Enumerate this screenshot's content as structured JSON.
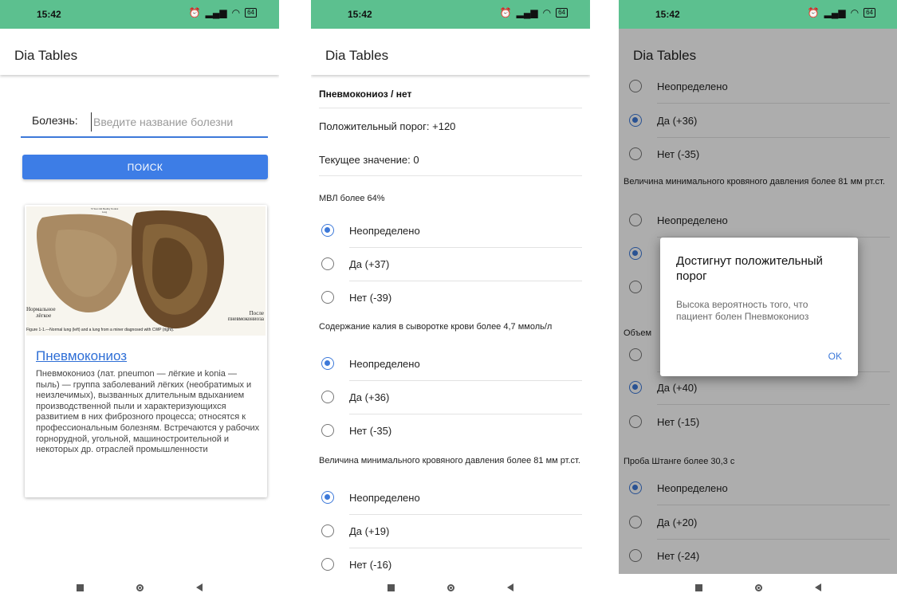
{
  "status": {
    "time": "15:42",
    "battery": "64"
  },
  "app_title": "Dia Tables",
  "search_screen": {
    "label": "Болезнь:",
    "placeholder": "Введите название болезни",
    "button_label": "ПОИСК",
    "card": {
      "image_top_label": "70 Year Old Healthy Normal Lung",
      "image_label_left_1": "Нормальное",
      "image_label_left_2": "лёгкое",
      "image_label_right_1": "После",
      "image_label_right_2": "пневмокониоза",
      "image_caption": "Figure 1-1.—Normal lung (left) and a lung from a miner diagnosed with CWP (right).",
      "title": "Пневмокониоз",
      "description": "Пневмокониоз (лат. pneumon — лёгкие и konia — пыль) — группа заболеваний лёгких (необратимых и неизлечимых), вызванных длительным вдыханием производственной пыли и характеризующихся развитием в них фиброзного процесса; относятся к профессиональным болезням. Встречаются у рабочих горнорудной, угольной, машиностроительной и некоторых др. отраслей промышленности"
    }
  },
  "table_screen": {
    "header": "Пневмокониоз / нет",
    "threshold": "Положительный порог: +120",
    "current": "Текущее значение: 0",
    "q1": {
      "title": "МВЛ более 64%",
      "options": [
        "Неопределено",
        "Да (+37)",
        "Нет (-39)"
      ]
    },
    "q2": {
      "title": "Содержание калия в сыворотке крови более 4,7 ммоль/л",
      "options": [
        "Неопределено",
        "Да (+36)",
        "Нет (-35)"
      ]
    },
    "q3": {
      "title": "Величина минимального кровяного давления более 81 мм рт.ст.",
      "options": [
        "Неопределено",
        "Да (+19)",
        "Нет (-16)"
      ]
    }
  },
  "dialog_screen": {
    "opts_a": [
      "Неопределено",
      "Да (+36)",
      "Нет (-35)"
    ],
    "q_pressure": "Величина минимального кровяного давления более 81 мм рт.ст.",
    "opts_b": [
      "Неопределено"
    ],
    "q_partial": "Объем",
    "opts_c": [
      "Да (+40)",
      "Нет (-15)"
    ],
    "q_shtange": "Проба Штанге более 30,3 с",
    "opts_d": [
      "Неопределено",
      "Да (+20)",
      "Нет (-24)"
    ],
    "dialog": {
      "title": "Достигнут положительный порог",
      "message": "Высока вероятность того, что пациент болен Пневмокониоз",
      "ok_label": "OK"
    }
  }
}
